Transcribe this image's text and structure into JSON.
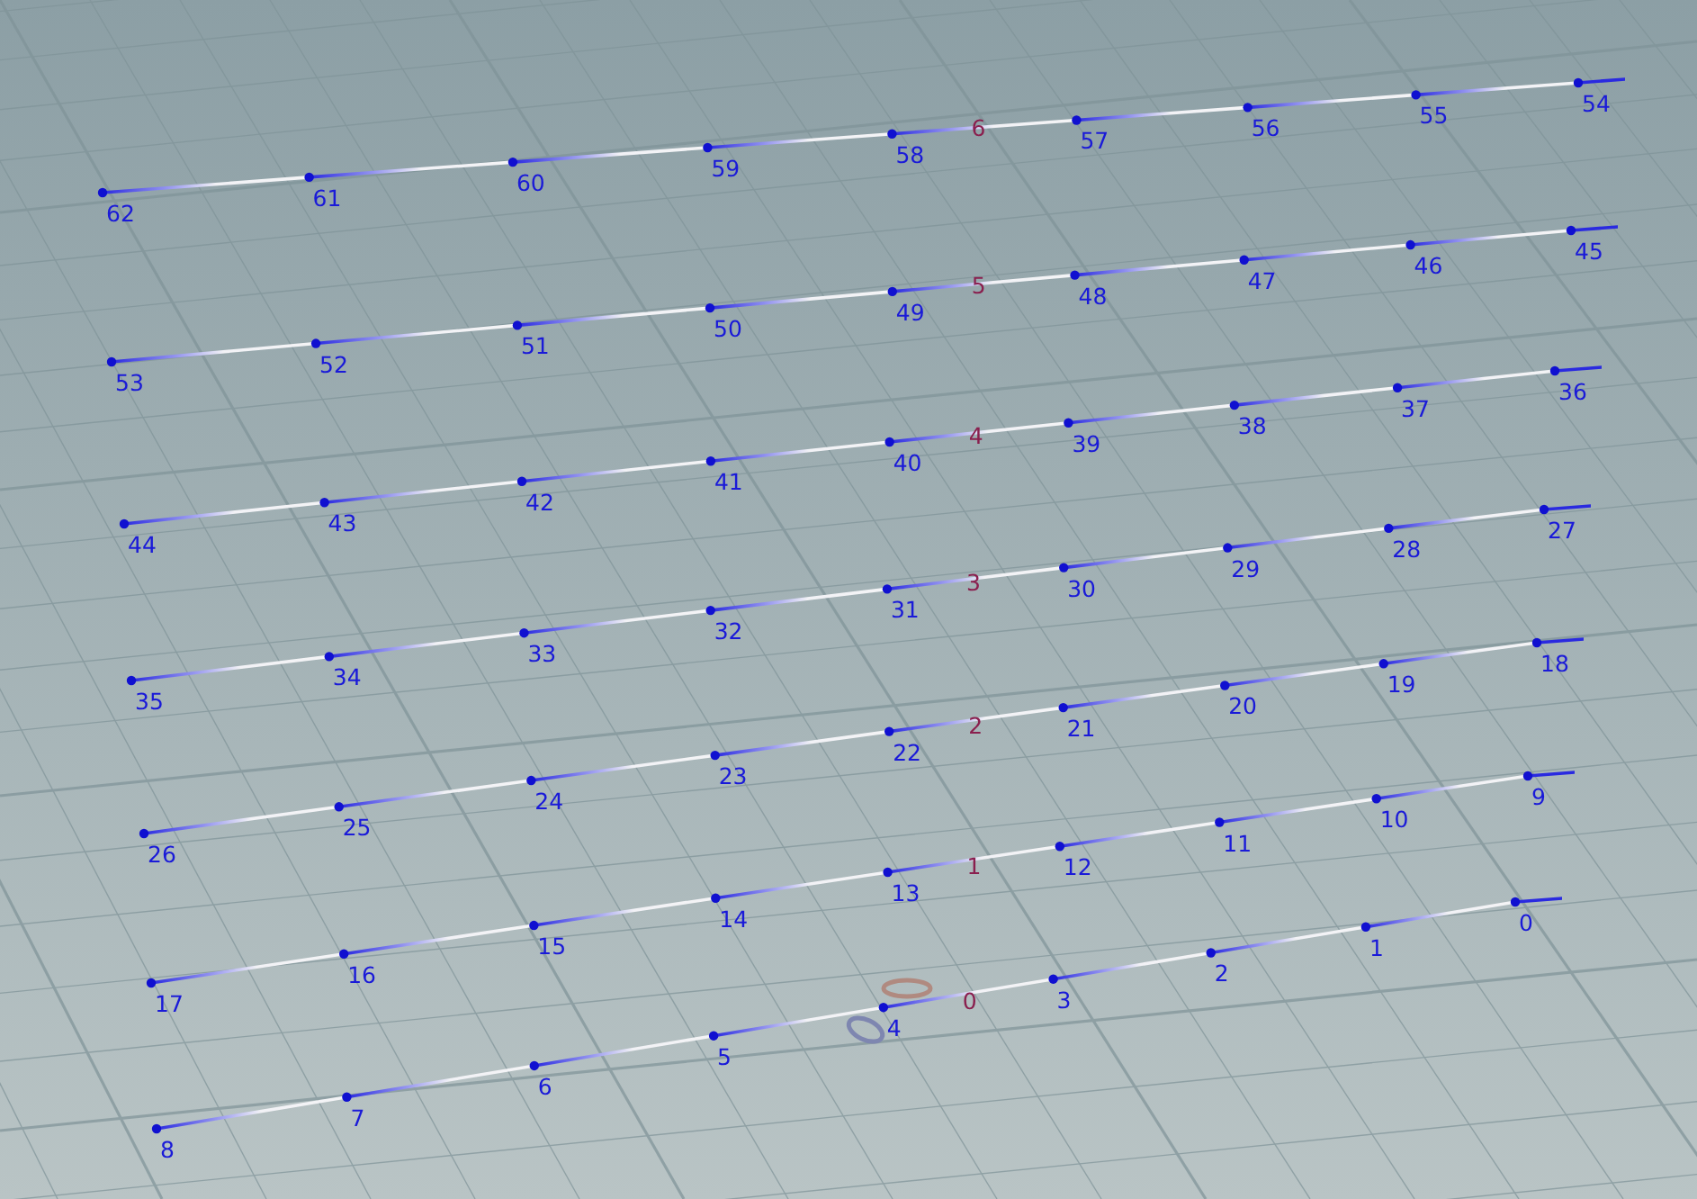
{
  "viewport": {
    "primitives": [
      {
        "label": "6",
        "points": [
          "62",
          "61",
          "60",
          "59",
          "58",
          "57",
          "56",
          "55",
          "54"
        ]
      },
      {
        "label": "5",
        "points": [
          "53",
          "52",
          "51",
          "50",
          "49",
          "48",
          "47",
          "46",
          "45"
        ]
      },
      {
        "label": "4",
        "points": [
          "44",
          "43",
          "42",
          "41",
          "40",
          "39",
          "38",
          "37",
          "36"
        ]
      },
      {
        "label": "3",
        "points": [
          "35",
          "34",
          "33",
          "32",
          "31",
          "30",
          "29",
          "28",
          "27"
        ]
      },
      {
        "label": "2",
        "points": [
          "26",
          "25",
          "24",
          "23",
          "22",
          "21",
          "20",
          "19",
          "18"
        ]
      },
      {
        "label": "1",
        "points": [
          "17",
          "16",
          "15",
          "14",
          "13",
          "12",
          "11",
          "10",
          "9"
        ]
      },
      {
        "label": "0",
        "points": [
          "8",
          "7",
          "6",
          "5",
          "4",
          "3",
          "2",
          "1",
          "0"
        ]
      }
    ]
  }
}
